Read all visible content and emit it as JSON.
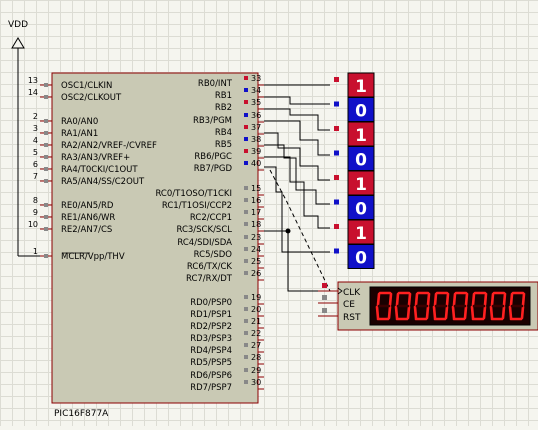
{
  "power": {
    "label": "VDD"
  },
  "mcu": {
    "part_name": "PIC16F877A",
    "left_pins": [
      {
        "num": "13",
        "name": "OSC1/CLKIN"
      },
      {
        "num": "14",
        "name": "OSC2/CLKOUT"
      },
      {
        "num": "2",
        "name": "RA0/AN0"
      },
      {
        "num": "3",
        "name": "RA1/AN1"
      },
      {
        "num": "4",
        "name": "RA2/AN2/VREF-/CVREF"
      },
      {
        "num": "5",
        "name": "RA3/AN3/VREF+"
      },
      {
        "num": "6",
        "name": "RA4/T0CKI/C1OUT"
      },
      {
        "num": "7",
        "name": "RA5/AN4/SS/C2OUT"
      },
      {
        "num": "8",
        "name": "RE0/AN5/RD"
      },
      {
        "num": "9",
        "name": "RE1/AN6/WR"
      },
      {
        "num": "10",
        "name": "RE2/AN7/CS"
      },
      {
        "num": "1",
        "name": "MCLR/Vpp/THV"
      }
    ],
    "right_pins": [
      {
        "num": "33",
        "name": "RB0/INT"
      },
      {
        "num": "34",
        "name": "RB1"
      },
      {
        "num": "35",
        "name": "RB2"
      },
      {
        "num": "36",
        "name": "RB3/PGM"
      },
      {
        "num": "37",
        "name": "RB4"
      },
      {
        "num": "38",
        "name": "RB5"
      },
      {
        "num": "39",
        "name": "RB6/PGC"
      },
      {
        "num": "40",
        "name": "RB7/PGD"
      },
      {
        "num": "15",
        "name": "RC0/T1OSO/T1CKI"
      },
      {
        "num": "16",
        "name": "RC1/T1OSI/CCP2"
      },
      {
        "num": "17",
        "name": "RC2/CCP1"
      },
      {
        "num": "18",
        "name": "RC3/SCK/SCL"
      },
      {
        "num": "23",
        "name": "RC4/SDI/SDA"
      },
      {
        "num": "24",
        "name": "RC5/SDO"
      },
      {
        "num": "25",
        "name": "RC6/TX/CK"
      },
      {
        "num": "26",
        "name": "RC7/RX/DT"
      },
      {
        "num": "19",
        "name": "RD0/PSP0"
      },
      {
        "num": "20",
        "name": "RD1/PSP1"
      },
      {
        "num": "21",
        "name": "RD2/PSP2"
      },
      {
        "num": "22",
        "name": "RD3/PSP3"
      },
      {
        "num": "27",
        "name": "RD4/PSP4"
      },
      {
        "num": "28",
        "name": "RD5/PSP5"
      },
      {
        "num": "29",
        "name": "RD6/PSP6"
      },
      {
        "num": "30",
        "name": "RD7/PSP7"
      }
    ]
  },
  "logic_probes": [
    {
      "value": "1",
      "state": "high"
    },
    {
      "value": "0",
      "state": "low"
    },
    {
      "value": "1",
      "state": "high"
    },
    {
      "value": "0",
      "state": "low"
    },
    {
      "value": "1",
      "state": "high"
    },
    {
      "value": "0",
      "state": "low"
    },
    {
      "value": "1",
      "state": "high"
    },
    {
      "value": "0",
      "state": "low"
    }
  ],
  "counter": {
    "pins": [
      "CLK",
      "CE",
      "RST"
    ],
    "display_value": "00000000",
    "first_digit_overflow": "1"
  },
  "colors": {
    "high": "#c8102e",
    "low": "#1010c8",
    "body_fill": "#c9c9b4",
    "wire": "#000000",
    "pin_line": "#8b0000",
    "segment_on": "#ff2020",
    "segment_off": "#3a0000"
  }
}
